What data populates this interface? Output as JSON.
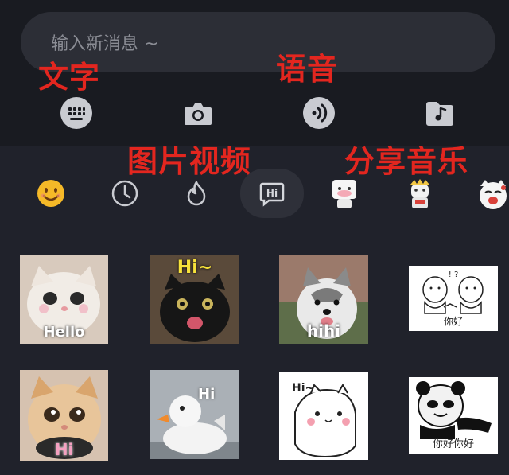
{
  "input": {
    "placeholder": "输入新消息 ~"
  },
  "annotations": {
    "text": "文字",
    "voice": "语音",
    "media": "图片视频",
    "music": "分享音乐"
  },
  "toolbar": {
    "icons": [
      "keyboard-icon",
      "camera-icon",
      "voice-icon",
      "music-folder-icon"
    ]
  },
  "tabs": [
    {
      "icon": "emoji-icon"
    },
    {
      "icon": "clock-icon"
    },
    {
      "icon": "flame-icon"
    },
    {
      "icon": "hi-bubble-icon",
      "selected": true
    },
    {
      "icon": "sticker-pack-1"
    },
    {
      "icon": "sticker-pack-2"
    },
    {
      "icon": "sticker-pack-3"
    }
  ],
  "stickers": [
    {
      "caption": "Hello"
    },
    {
      "caption": "Hi~"
    },
    {
      "caption": "hihi"
    },
    {
      "caption": "你好"
    },
    {
      "caption": "Hi"
    },
    {
      "caption": "Hi"
    },
    {
      "caption": "Hi~"
    },
    {
      "caption": "你好你好"
    }
  ],
  "colors": {
    "annotation": "#e3261f",
    "background": "#20222b",
    "top": "#191b21"
  }
}
